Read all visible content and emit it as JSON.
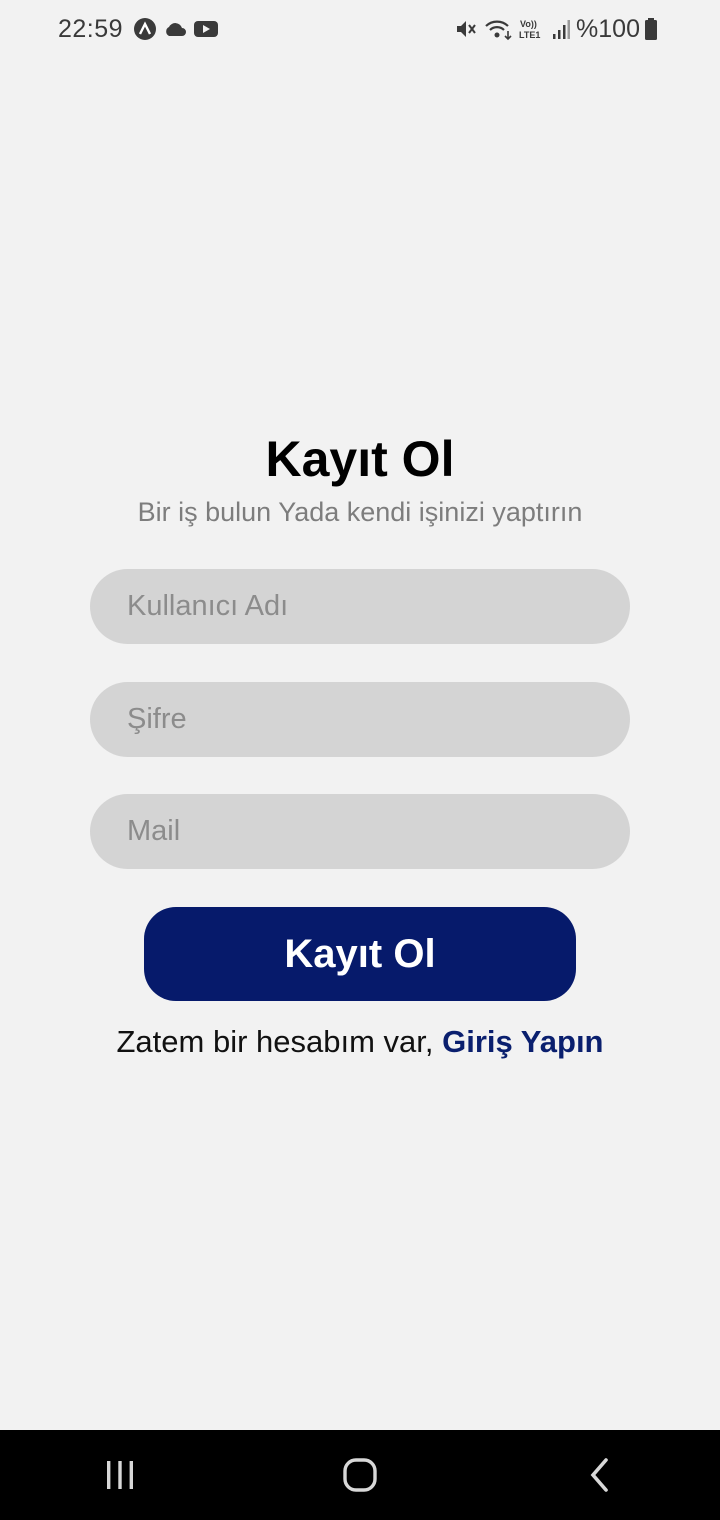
{
  "status_bar": {
    "time": "22:59",
    "left_icons": [
      "nav-app-icon",
      "cloud-icon",
      "youtube-icon"
    ],
    "right_icons": [
      "mute-icon",
      "wifi-icon",
      "volte-lte-icon",
      "signal-icon",
      "battery-icon"
    ],
    "volte_text": "Vo)) LTE1",
    "battery": "%100"
  },
  "register": {
    "title": "Kayıt Ol",
    "subtitle": "Bir iş bulun Yada kendi işinizi yaptırın",
    "username_placeholder": "Kullanıcı Adı",
    "password_placeholder": "Şifre",
    "mail_placeholder": "Mail",
    "submit_label": "Kayıt Ol",
    "login_prompt": "Zatem bir hesabım var, ",
    "login_link": "Giriş Yapın"
  },
  "nav_bar": {
    "buttons": [
      "recents-icon",
      "home-icon",
      "back-icon"
    ]
  },
  "colors": {
    "background": "#f2f2f2",
    "field": "#d4d4d4",
    "primary": "#061a6b",
    "link": "#0a1f6e",
    "subtitle": "#7d7d7d"
  }
}
